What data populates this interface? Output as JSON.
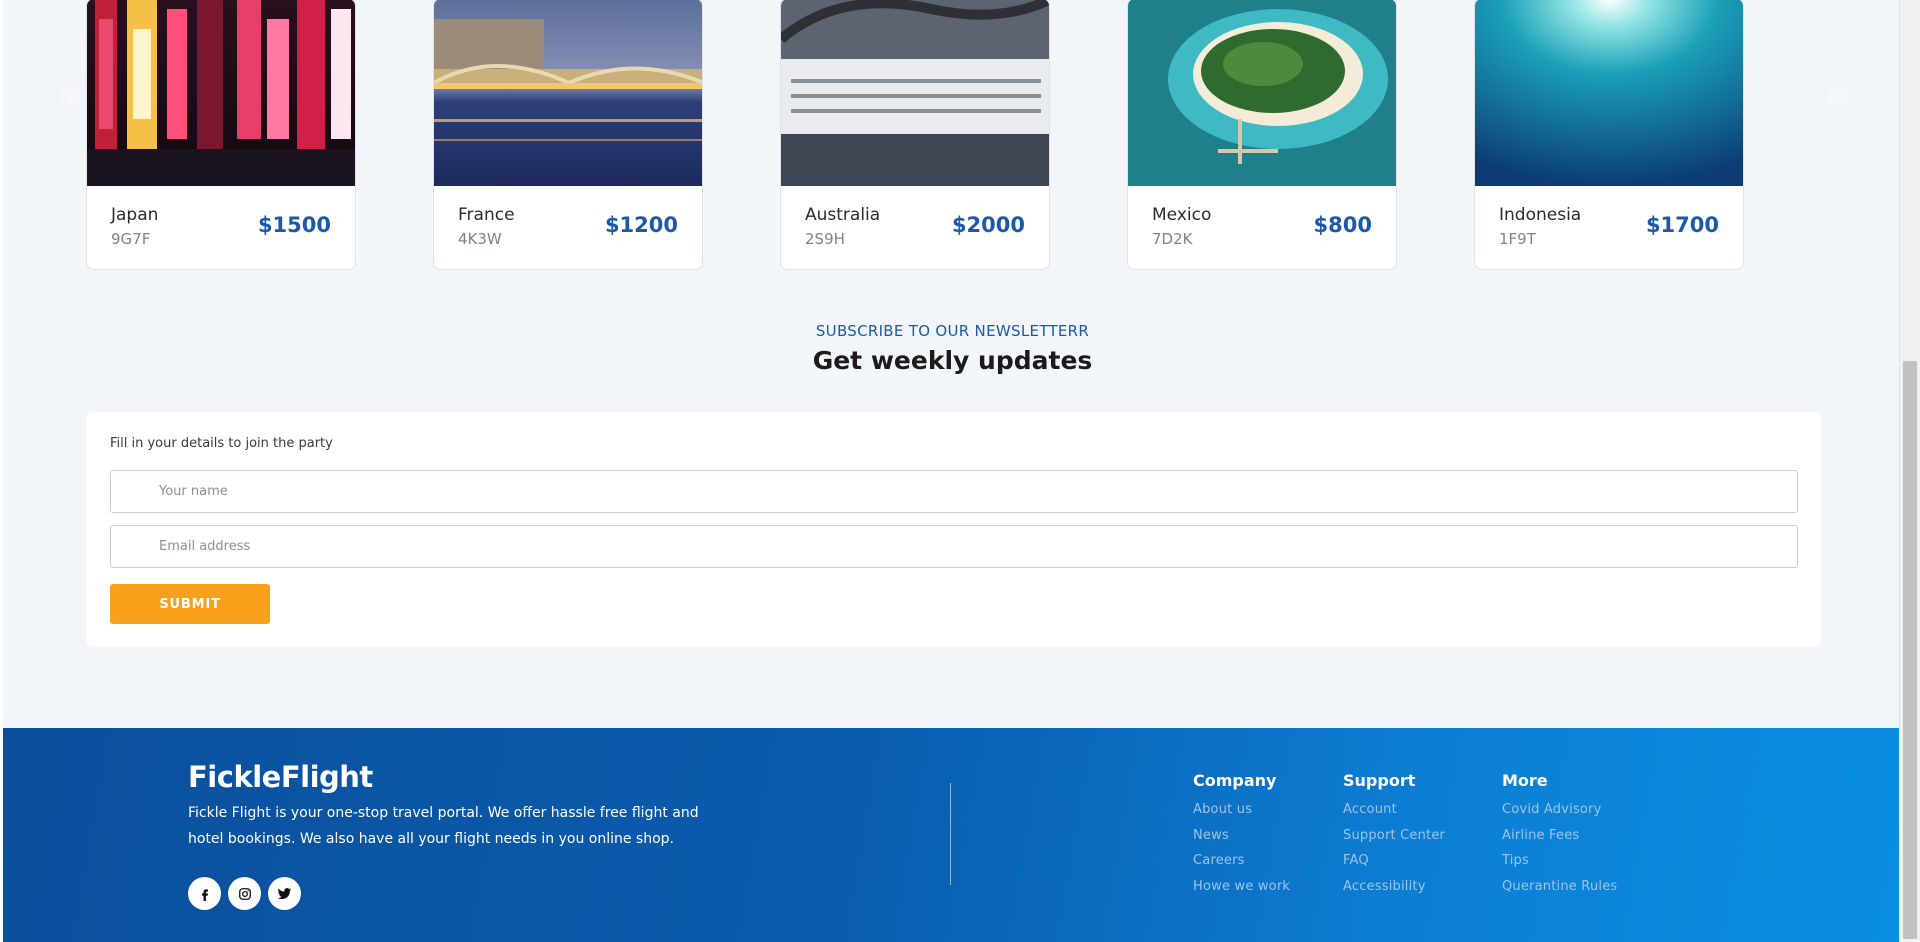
{
  "carousel": {
    "prev_icon": "chevron-left-icon",
    "next_icon": "chevron-right-icon",
    "destinations": [
      {
        "name": "Japan",
        "code": "9G7F",
        "price": "$1500"
      },
      {
        "name": "France",
        "code": "4K3W",
        "price": "$1200"
      },
      {
        "name": "Australia",
        "code": "2S9H",
        "price": "$2000"
      },
      {
        "name": "Mexico",
        "code": "7D2K",
        "price": "$800"
      },
      {
        "name": "Indonesia",
        "code": "1F9T",
        "price": "$1700"
      }
    ]
  },
  "newsletter": {
    "kicker": "SUBSCRIBE TO OUR NEWSLETTERR",
    "title": "Get weekly updates",
    "form_label": "Fill in your details to join the party",
    "name_placeholder": "Your name",
    "email_placeholder": "Email address",
    "submit_label": "SUBMIT"
  },
  "footer": {
    "logo": "FickleFlight",
    "about": "Fickle Flight is your one-stop travel portal. We offer hassle free flight and hotel bookings. We also have all your flight needs in you online shop.",
    "socials": [
      "facebook-icon",
      "instagram-icon",
      "twitter-icon"
    ],
    "columns": {
      "company": {
        "title": "Company",
        "links": [
          "About us",
          "News",
          "Careers",
          "Howe we work"
        ]
      },
      "support": {
        "title": "Support",
        "links": [
          "Account",
          "Support Center",
          "FAQ",
          "Accessibility"
        ]
      },
      "more": {
        "title": "More",
        "links": [
          "Covid Advisory",
          "Airline Fees",
          "Tips",
          "Querantine Rules"
        ]
      }
    }
  },
  "colors": {
    "brand_blue": "#1c5aa8",
    "accent_orange": "#f8a01a",
    "footer_blue": "#0a5cae"
  }
}
